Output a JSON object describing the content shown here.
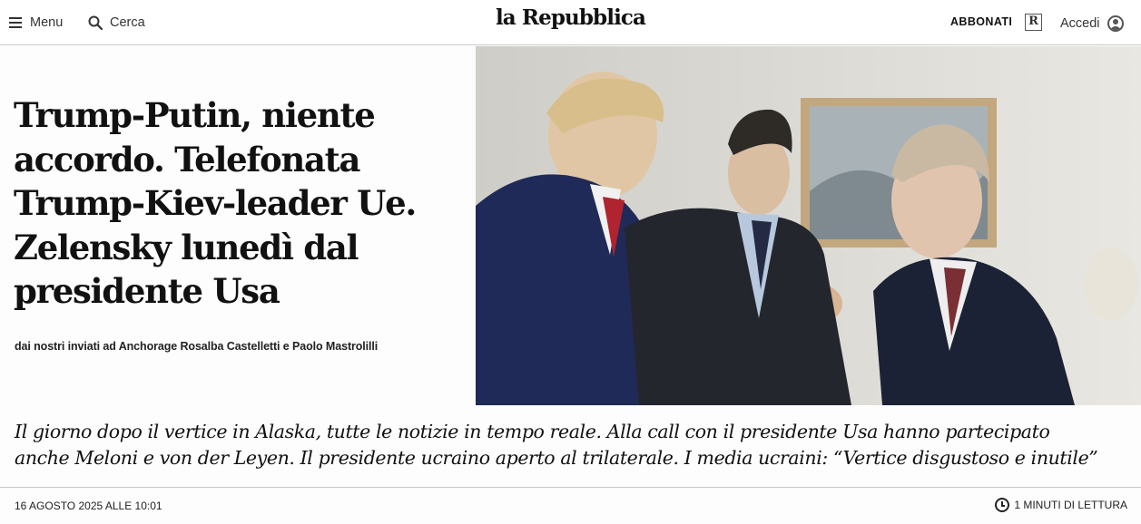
{
  "header": {
    "menu_label": "Menu",
    "search_label": "Cerca",
    "logo_text": "la Repubblica",
    "subscribe_label": "ABBONATI",
    "r_badge": "R",
    "login_label": "Accedi"
  },
  "article": {
    "headline_lines": [
      "Trump-Putin, niente",
      "accordo. Telefonata",
      "Trump-Kiev-leader Ue.",
      "Zelensky lunedì dal",
      "presidente Usa"
    ],
    "byline": "dai nostri inviati ad Anchorage Rosalba Castelletti e Paolo Mastrolilli",
    "summary_lines": [
      "Il giorno dopo il vertice in Alaska, tutte le notizie in tempo reale. Alla call con il presidente Usa hanno partecipato",
      "anche Meloni e von der Leyen. Il presidente ucraino aperto al trilaterale. I media ucraini: “Vertice disgustoso e inutile”"
    ],
    "date": "16 AGOSTO 2025 ALLE 10:01",
    "reading_time": "1 MINUTI DI LETTURA"
  },
  "icons": [
    "hamburger-icon",
    "search-icon",
    "r-badge-icon",
    "user-icon",
    "clock-icon"
  ],
  "colors": {
    "text": "#111111",
    "divider": "#c9c9c9",
    "background": "#fdfdfd"
  }
}
